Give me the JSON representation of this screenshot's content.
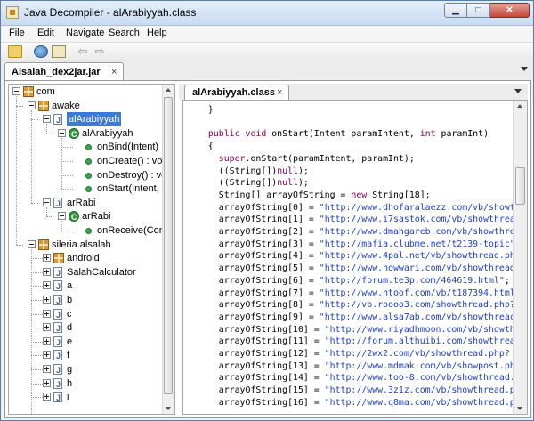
{
  "window": {
    "title": "Java Decompiler - alArabiyyah.class",
    "min_icon": "minimize-icon",
    "max_icon": "maximize-icon",
    "close_icon": "close-icon"
  },
  "menu": [
    "File",
    "Edit",
    "Navigate",
    "Search",
    "Help"
  ],
  "toolbar": {
    "icons": [
      "open-file-icon",
      "browse-icon",
      "search-icon",
      "back-arrow-icon",
      "forward-arrow-icon"
    ]
  },
  "outer_tab": {
    "label": "Alsalah_dex2jar.jar",
    "close": "×"
  },
  "editor_tab": {
    "label": "alArabiyyah.class",
    "close": "×"
  },
  "tree": [
    {
      "label": "com",
      "icon": "package",
      "exp": "minus"
    },
    {
      "label": "awake",
      "icon": "package",
      "exp": "minus"
    },
    {
      "label": "alArabiyyah",
      "icon": "java",
      "exp": "minus",
      "selected": true
    },
    {
      "label": "alArabiyyah",
      "icon": "class",
      "exp": "minus"
    },
    {
      "label": "onBind(Intent)",
      "icon": "method"
    },
    {
      "label": "onCreate() : voi",
      "icon": "method"
    },
    {
      "label": "onDestroy() : vc",
      "icon": "method"
    },
    {
      "label": "onStart(Intent,",
      "icon": "method"
    },
    {
      "label": "arRabi",
      "icon": "java",
      "exp": "minus"
    },
    {
      "label": "arRabi",
      "icon": "class",
      "exp": "minus"
    },
    {
      "label": "onReceive(Con",
      "icon": "method"
    },
    {
      "label": "sileria.alsalah",
      "icon": "package",
      "exp": "minus"
    },
    {
      "label": "android",
      "icon": "package",
      "exp": "plus"
    },
    {
      "label": "SalahCalculator",
      "icon": "java",
      "exp": "plus"
    },
    {
      "label": "a",
      "icon": "java",
      "exp": "plus"
    },
    {
      "label": "b",
      "icon": "java",
      "exp": "plus"
    },
    {
      "label": "c",
      "icon": "java",
      "exp": "plus"
    },
    {
      "label": "d",
      "icon": "java",
      "exp": "plus"
    },
    {
      "label": "e",
      "icon": "java",
      "exp": "plus"
    },
    {
      "label": "f",
      "icon": "java",
      "exp": "plus"
    },
    {
      "label": "g",
      "icon": "java",
      "exp": "plus"
    },
    {
      "label": "h",
      "icon": "java",
      "exp": "plus"
    },
    {
      "label": "i",
      "icon": "java",
      "exp": "plus"
    }
  ],
  "code_lines": [
    "  }",
    "",
    "  public void onStart(Intent paramIntent, int paramInt)",
    "  {",
    "    super.onStart(paramIntent, paramInt);",
    "    ((String[])null);",
    "    ((String[])null);",
    "    String[] arrayOfString = new String[18];",
    "    arrayOfString[0] = \"http://www.dhofaralaezz.com/vb/showt",
    "    arrayOfString[1] = \"http://www.i7sastok.com/vb/showthrea",
    "    arrayOfString[2] = \"http://www.dmahgareb.com/vb/showthre",
    "    arrayOfString[3] = \"http://mafia.clubme.net/t2139-topic\"",
    "    arrayOfString[4] = \"http://www.4pal.net/vb/showthread.ph",
    "    arrayOfString[5] = \"http://www.howwari.com/vb/showthread",
    "    arrayOfString[6] = \"http://forum.te3p.com/464619.html\";",
    "    arrayOfString[7] = \"http://www.htoof.com/vb/t187394.html",
    "    arrayOfString[8] = \"http://vb.roooo3.com/showthread.php?",
    "    arrayOfString[9] = \"http://www.alsa7ab.com/vb/showthreac",
    "    arrayOfString[10] = \"http://www.riyadhmoon.com/vb/showth",
    "    arrayOfString[11] = \"http://forum.althuibi.com/showthrea",
    "    arrayOfString[12] = \"http://2wx2.com/vb/showthread.php?",
    "    arrayOfString[13] = \"http://www.mdmak.com/vb/showpost.ph",
    "    arrayOfString[14] = \"http://www.too-8.com/vb/showthread.",
    "    arrayOfString[15] = \"http://www.3z1z.com/vb/showthread.p",
    "    arrayOfString[16] = \"http://www.q8ma.com/vb/showthread.p"
  ],
  "colors": {
    "keyword": "#7f0055",
    "string": "#1f3fc8",
    "selection": "#3a7bd5"
  }
}
